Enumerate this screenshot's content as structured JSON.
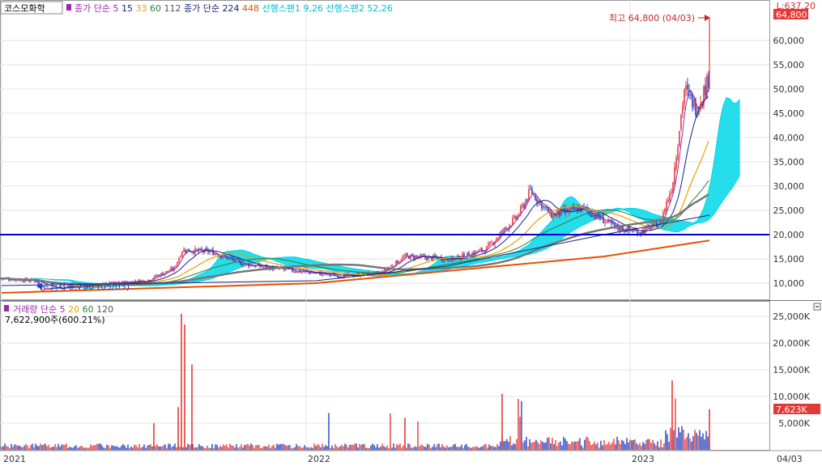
{
  "stock_name": "코스모화학",
  "price_legend": [
    {
      "text": "종가 단순",
      "color": "#9c27b0"
    },
    {
      "text": "5",
      "color": "#9c27b0"
    },
    {
      "text": "15",
      "color": "#1a237e"
    },
    {
      "text": "33",
      "color": "#e6a100"
    },
    {
      "text": "60",
      "color": "#2e7d32"
    },
    {
      "text": "112",
      "color": "#555555"
    },
    {
      "text": "종가 단순",
      "color": "#1a237e"
    },
    {
      "text": "224",
      "color": "#1a237e"
    },
    {
      "text": "448",
      "color": "#e65100"
    },
    {
      "text": "선행스팬1 9,26",
      "color": "#00bcd4"
    },
    {
      "text": "선행스팬2 52,26",
      "color": "#00bcd4"
    }
  ],
  "top_right_label": "L:637.20",
  "current_price_tag": "64,800",
  "high_annotation": "최고 64,800 (04/03)",
  "low_annotation": "최저 8,790 (05/03)",
  "volume_legend": [
    {
      "text": "거래량 단순",
      "color": "#9c27b0"
    },
    {
      "text": "5",
      "color": "#9c27b0"
    },
    {
      "text": "20",
      "color": "#e6a100"
    },
    {
      "text": "60",
      "color": "#2e7d32"
    },
    {
      "text": "120",
      "color": "#555555"
    }
  ],
  "volume_info": "7,622,900주(600.21%)",
  "volume_tag": "7,623K",
  "x_ticks": [
    "2021",
    "2022",
    "2023",
    "04/03"
  ],
  "colors": {
    "up": "#e53935",
    "down": "#1e40c8",
    "ichimoku": "#00d7e8",
    "hline": "#0000cc",
    "tag_bg": "#e53935"
  },
  "chart_data": [
    {
      "type": "line",
      "title": "코스모화학",
      "y_ticks": [
        "10,000",
        "15,000",
        "20,000",
        "25,000",
        "30,000",
        "35,000",
        "40,000",
        "45,000",
        "50,000",
        "55,000",
        "60,000"
      ],
      "ylim": [
        7000,
        66000
      ],
      "horizontal_line": 20000,
      "series": [
        {
          "name": "종가",
          "x": [
            "2021-01",
            "2021-04",
            "2021-05",
            "2021-08",
            "2021-10",
            "2021-12",
            "2022-03",
            "2022-05",
            "2022-06",
            "2022-09",
            "2022-10",
            "2022-12",
            "2023-01",
            "2023-02",
            "2023-03",
            "2023-04-03"
          ],
          "values": [
            11000,
            10000,
            8790,
            16000,
            14000,
            12000,
            11500,
            15500,
            15000,
            29000,
            24500,
            21000,
            22500,
            48000,
            51000,
            64800
          ]
        },
        {
          "name": "224",
          "x": [
            "2021-01",
            "2022-01",
            "2022-06",
            "2022-12",
            "2023-04-03"
          ],
          "values": [
            9500,
            10500,
            13500,
            20000,
            24000
          ]
        },
        {
          "name": "448",
          "x": [
            "2021-01",
            "2022-01",
            "2022-06",
            "2022-12",
            "2023-04-03"
          ],
          "values": [
            8000,
            10000,
            12500,
            15500,
            18800
          ]
        }
      ]
    },
    {
      "type": "bar",
      "title": "거래량",
      "y_ticks": [
        "5,000K",
        "10,000K",
        "15,000K",
        "20,000K",
        "25,000K"
      ],
      "ylim": [
        0,
        27000
      ],
      "peaks": [
        {
          "x": "2021-08",
          "value": 25500
        },
        {
          "x": "2023-02",
          "value": 13000
        },
        {
          "x": "2023-04-03",
          "value": 7623
        }
      ]
    }
  ]
}
